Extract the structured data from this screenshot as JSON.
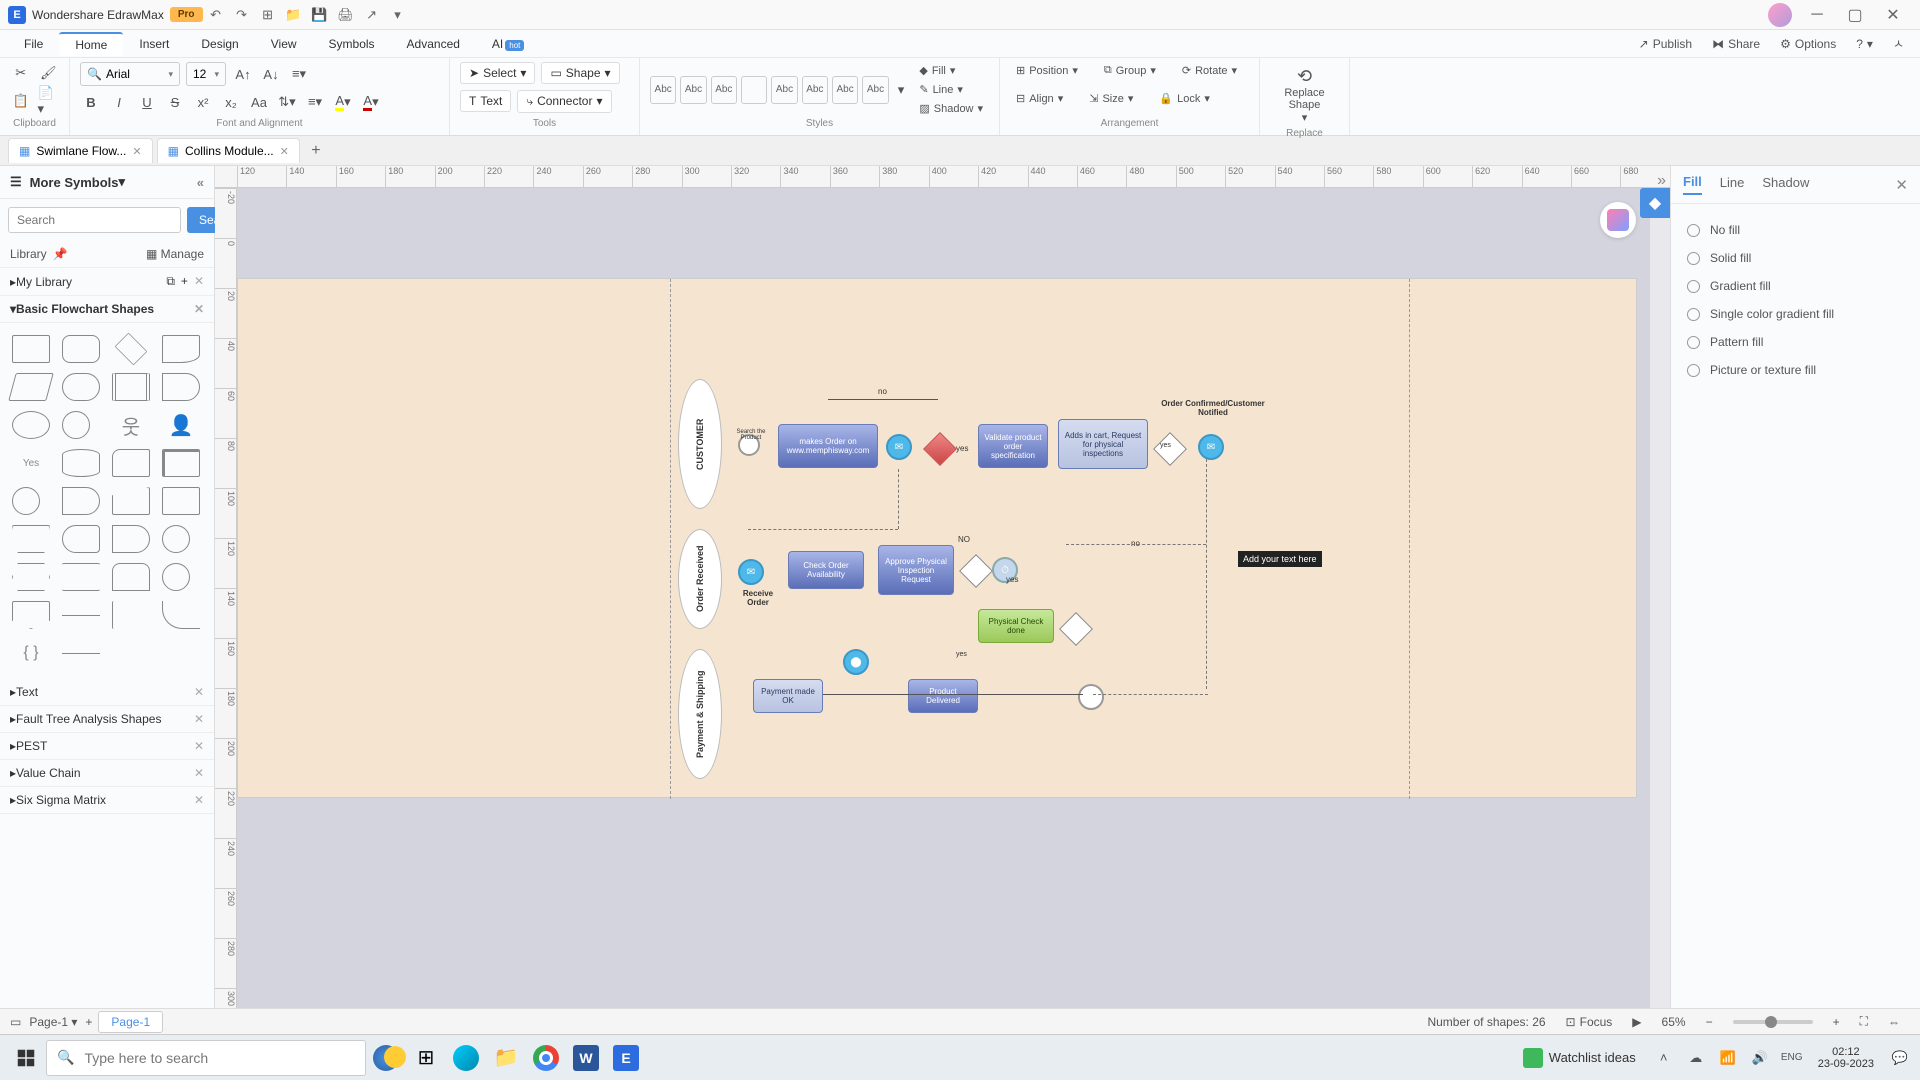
{
  "titlebar": {
    "app_name": "Wondershare EdrawMax",
    "pro": "Pro"
  },
  "menubar": {
    "items": [
      "File",
      "Home",
      "Insert",
      "Design",
      "View",
      "Symbols",
      "Advanced",
      "AI"
    ],
    "hot": "hot",
    "right": {
      "publish": "Publish",
      "share": "Share",
      "options": "Options"
    }
  },
  "ribbon": {
    "clipboard_label": "Clipboard",
    "font_label": "Font and Alignment",
    "font_family": "Arial",
    "font_size": "12",
    "tools_label": "Tools",
    "select": "Select",
    "shape": "Shape",
    "text": "Text",
    "connector": "Connector",
    "styles_label": "Styles",
    "style_swatch": "Abc",
    "fill": "Fill",
    "line": "Line",
    "shadow": "Shadow",
    "arrangement_label": "Arrangement",
    "position": "Position",
    "group": "Group",
    "rotate": "Rotate",
    "align": "Align",
    "size": "Size",
    "lock": "Lock",
    "replace_label": "Replace",
    "replace_shape": "Replace Shape"
  },
  "doc_tabs": {
    "tab1": "Swimlane Flow...",
    "tab2": "Collins Module..."
  },
  "left_panel": {
    "title": "More Symbols",
    "search_placeholder": "Search",
    "search_btn": "Search",
    "library": "Library",
    "manage": "Manage",
    "sections": {
      "my_library": "My Library",
      "basic": "Basic Flowchart Shapes",
      "text": "Text",
      "fault_tree": "Fault Tree Analysis Shapes",
      "pest": "PEST",
      "value_chain": "Value Chain",
      "six_sigma": "Six Sigma Matrix"
    },
    "yes_label": "Yes"
  },
  "ruler_h": [
    "120",
    "140",
    "160",
    "180",
    "200",
    "220",
    "240",
    "260",
    "280",
    "300",
    "320",
    "340",
    "360",
    "380",
    "400",
    "420",
    "440",
    "460",
    "480",
    "500",
    "520",
    "540",
    "560",
    "580",
    "600",
    "620",
    "640",
    "660",
    "680"
  ],
  "ruler_v": [
    "-20",
    "0",
    "20",
    "40",
    "60",
    "80",
    "100",
    "120",
    "140",
    "160",
    "180",
    "200",
    "220",
    "240",
    "260",
    "280",
    "300"
  ],
  "canvas": {
    "lane1": "CUSTOMER",
    "lane2": "Order Received",
    "lane3": "Payment & Shipping",
    "nodes": {
      "makes_order": "makes Order on www.memphisway.com",
      "validate": "Validate product order specification",
      "add_cart": "Adds in cart, Request for physical inspections",
      "confirmed": "Order Confirmed/Customer Notified",
      "check_avail": "Check Order Availability",
      "approve_insp": "Approve Physical Inspection Request",
      "receive_order": "Receive Order",
      "physical_check": "Physical Check done",
      "payment": "Payment made OK",
      "delivered": "Product Delivered",
      "edit_text": "Add your text here",
      "search_product": "Search the Product"
    },
    "labels": {
      "no": "no",
      "yes": "yes",
      "NO_big": "NO",
      "yes_big": "yes",
      "dash_no": "no",
      "dash_yes": "yes"
    }
  },
  "right_panel": {
    "tab_fill": "Fill",
    "tab_line": "Line",
    "tab_shadow": "Shadow",
    "opts": {
      "no_fill": "No fill",
      "solid": "Solid fill",
      "gradient": "Gradient fill",
      "single_gradient": "Single color gradient fill",
      "pattern": "Pattern fill",
      "picture": "Picture or texture fill"
    }
  },
  "statusbar": {
    "page_select": "Page-1",
    "page_tab": "Page-1",
    "shapes_count": "Number of shapes: 26",
    "focus": "Focus",
    "zoom": "65%"
  },
  "taskbar": {
    "search_placeholder": "Type here to search",
    "watchlist": "Watchlist ideas",
    "time": "02:12",
    "date": "23-09-2023"
  }
}
